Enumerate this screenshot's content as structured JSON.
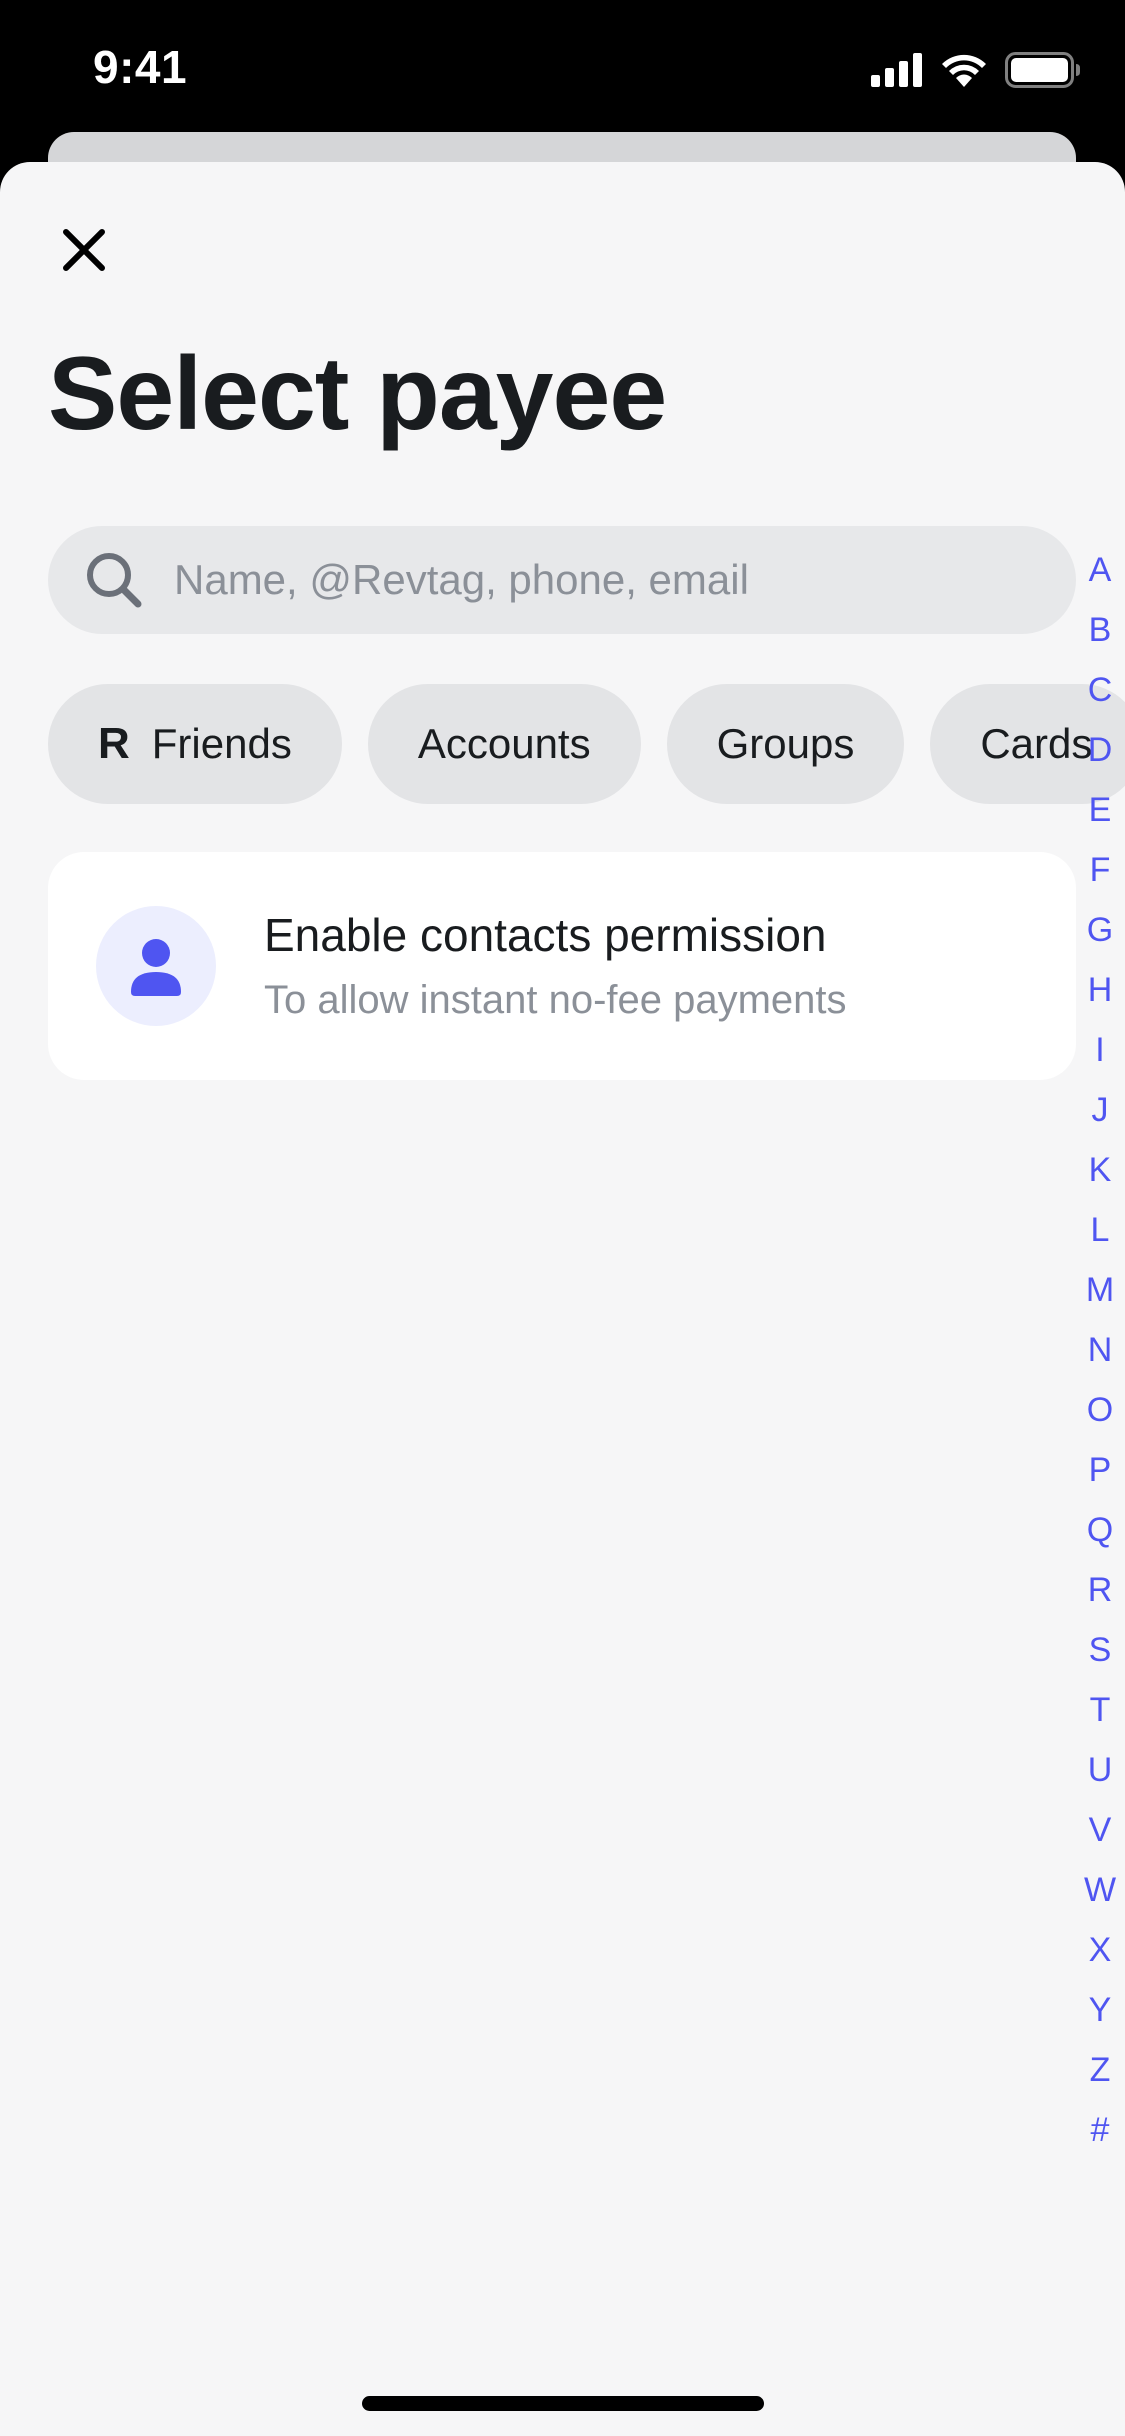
{
  "status_bar": {
    "time": "9:41",
    "icons": [
      "signal-icon",
      "wifi-icon",
      "battery-icon"
    ]
  },
  "header": {
    "close_icon": "close-icon",
    "title": "Select payee"
  },
  "search": {
    "placeholder": "Name, @Revtag, phone, email",
    "value": "",
    "icon": "search-icon"
  },
  "filters": [
    {
      "label": "Friends",
      "icon": "R"
    },
    {
      "label": "Accounts"
    },
    {
      "label": "Groups"
    },
    {
      "label": "Cards"
    }
  ],
  "permission_card": {
    "icon": "person-icon",
    "title": "Enable contacts permission",
    "subtitle": "To allow instant no-fee payments"
  },
  "alphabet_index": [
    "A",
    "B",
    "C",
    "D",
    "E",
    "F",
    "G",
    "H",
    "I",
    "J",
    "K",
    "L",
    "M",
    "N",
    "O",
    "P",
    "Q",
    "R",
    "S",
    "T",
    "U",
    "V",
    "W",
    "X",
    "Y",
    "Z",
    "#"
  ],
  "colors": {
    "accent": "#4f55f1",
    "sheet_background": "#f6f6f7",
    "chip_background": "#e3e4e6",
    "search_background": "#e7e8ea",
    "avatar_background": "#eceefe",
    "text_primary": "#191c1f",
    "text_secondary": "#8b9098"
  }
}
